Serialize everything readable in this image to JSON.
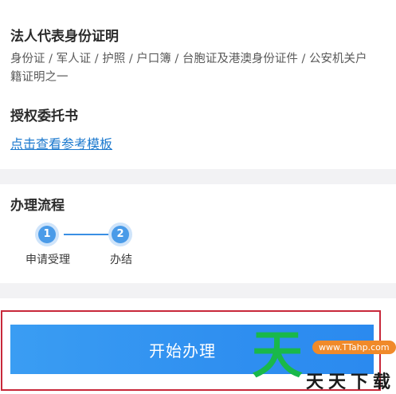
{
  "legal_rep_id": {
    "title": "法人代表身份证明",
    "description": "身份证 / 军人证 / 护照 / 户口簿 / 台胞证及港澳身份证件 / 公安机关户籍证明之一"
  },
  "authorization": {
    "title": "授权委托书",
    "template_link": "点击查看参考模板"
  },
  "process": {
    "title": "办理流程",
    "steps": [
      {
        "number": "1",
        "label": "申请受理"
      },
      {
        "number": "2",
        "label": "办结"
      }
    ]
  },
  "action": {
    "start_label": "开始办理"
  },
  "watermark": {
    "glyph": "天",
    "url": "www.TTahp.com",
    "text": "天天下载"
  },
  "colors": {
    "accent_blue": "#2f8ff0",
    "link_blue": "#1c79ce",
    "highlight_red": "#c8283a",
    "watermark_green": "#19b84a"
  }
}
